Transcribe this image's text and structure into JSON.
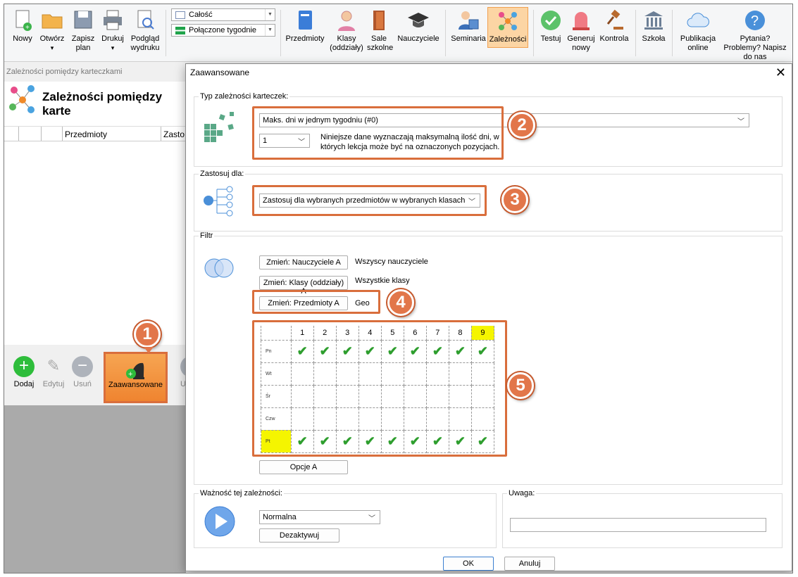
{
  "ribbon": {
    "buttons": [
      {
        "label": "Nowy",
        "icon": "new-document-icon"
      },
      {
        "label": "Otwórz",
        "icon": "folder-icon"
      },
      {
        "label": "Zapisz plan",
        "icon": "save-icon"
      },
      {
        "label": "Drukuj",
        "icon": "printer-icon"
      },
      {
        "label": "Podgląd wydruku",
        "icon": "print-preview-icon"
      },
      {
        "label": "Przedmioty",
        "icon": "book-icon"
      },
      {
        "label": "Klasy (oddziały)",
        "icon": "student-icon"
      },
      {
        "label": "Sale szkolne",
        "icon": "door-icon"
      },
      {
        "label": "Nauczyciele",
        "icon": "graduation-cap-icon"
      },
      {
        "label": "Seminaria",
        "icon": "teacher-board-icon"
      },
      {
        "label": "Zależności",
        "icon": "network-icon"
      },
      {
        "label": "Testuj",
        "icon": "check-badge-icon"
      },
      {
        "label": "Generuj nowy",
        "icon": "alarm-light-icon"
      },
      {
        "label": "Kontrola",
        "icon": "gavel-icon"
      },
      {
        "label": "Szkoła",
        "icon": "school-building-icon"
      },
      {
        "label": "Publikacja online",
        "icon": "cloud-icon"
      },
      {
        "label": "Pytania? Problemy? Napisz do nas",
        "icon": "question-icon"
      }
    ],
    "combo1": "Całość",
    "combo2": "Połączone tygodnie",
    "dropdown_arrow": "▾"
  },
  "left_window": {
    "title": "Zależności pomiędzy karteczkami",
    "heading": "Zależności pomiędzy karte",
    "col1": "Przedmioty",
    "col2": "Zasto",
    "add": "Dodaj",
    "edit": "Edytuj",
    "remove": "Usuń",
    "advanced": "Zaawansowane",
    "cut_label": "Ua"
  },
  "dialog": {
    "title": "Zaawansowane",
    "close": "✕",
    "type_group": "Typ zależności karteczek:",
    "type_value": "Maks. dni w jednym tygodniu (#0)",
    "param_value": "1",
    "param_desc": "Niniejsze dane wyznaczają maksymalną ilość dni, w których lekcja może być na oznaczonych pozycjach.",
    "apply_group": "Zastosuj dla:",
    "apply_value": "Zastosuj dla wybranych przedmiotów w wybranych klasach",
    "filter_group": "Filtr",
    "btn_teachers": "Zmień: Nauczyciele A",
    "teachers_value": "Wszyscy nauczyciele",
    "btn_classes": "Zmień: Klasy (oddziały) A",
    "classes_value": "Wszystkie klasy",
    "btn_subjects": "Zmień: Przedmioty A",
    "subjects_value": "Geo",
    "btn_options": "Opcje A",
    "importance_group": "Ważność tej zależności:",
    "importance_value": "Normalna",
    "btn_deactivate": "Dezaktywuj",
    "note_group": "Uwaga:",
    "ok": "OK",
    "cancel": "Anuluj"
  },
  "grid": {
    "periods": [
      "1",
      "2",
      "3",
      "4",
      "5",
      "6",
      "7",
      "8",
      "9"
    ],
    "highlighted_period": "9",
    "rows": [
      {
        "day": "Pn",
        "checked": [
          1,
          1,
          1,
          1,
          1,
          1,
          1,
          1,
          1
        ],
        "highlight": false
      },
      {
        "day": "Wt",
        "checked": [
          0,
          0,
          0,
          0,
          0,
          0,
          0,
          0,
          0
        ],
        "highlight": false
      },
      {
        "day": "Śr",
        "checked": [
          0,
          0,
          0,
          0,
          0,
          0,
          0,
          0,
          0
        ],
        "highlight": false
      },
      {
        "day": "Czw",
        "checked": [
          0,
          0,
          0,
          0,
          0,
          0,
          0,
          0,
          0
        ],
        "highlight": false
      },
      {
        "day": "Pt",
        "checked": [
          1,
          1,
          1,
          1,
          1,
          1,
          1,
          1,
          1
        ],
        "highlight": true
      }
    ],
    "check_glyph": "✔"
  },
  "callouts": [
    "1",
    "2",
    "3",
    "4",
    "5"
  ],
  "colors": {
    "accent": "#e2764a",
    "highlight": "#f5f500",
    "check": "#2e9e2e",
    "active_tab": "#fcd5a4"
  }
}
